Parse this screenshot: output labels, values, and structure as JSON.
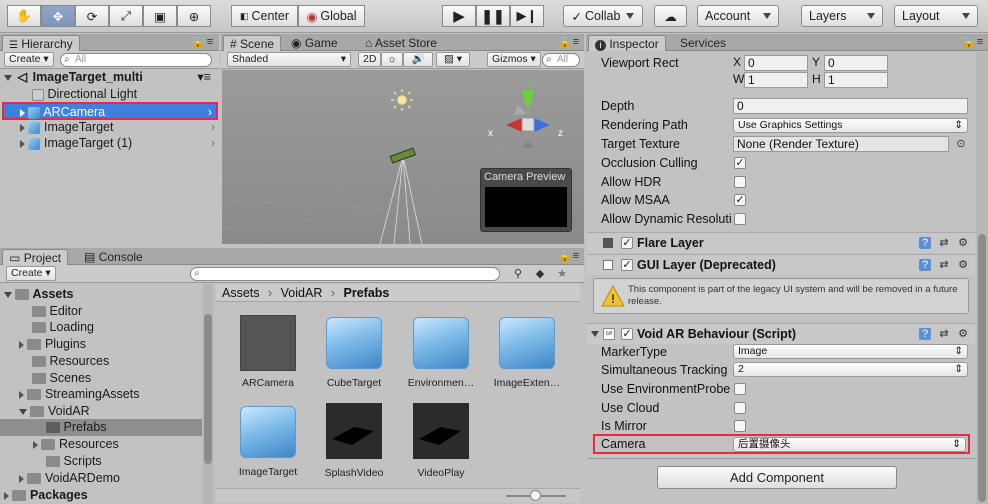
{
  "toolbar": {
    "pivot_label": "Center",
    "space_label": "Global",
    "collab_label": "Collab",
    "account_label": "Account",
    "layers_label": "Layers",
    "layout_label": "Layout"
  },
  "hierarchy": {
    "tab": "Hierarchy",
    "create_label": "Create",
    "search_placeholder": "All",
    "scene_name": "ImageTarget_multi",
    "items": [
      {
        "label": "Directional Light",
        "icon": "gameobject-icon"
      },
      {
        "label": "ARCamera",
        "icon": "cube-icon"
      },
      {
        "label": "ImageTarget",
        "icon": "cube-icon"
      },
      {
        "label": "ImageTarget (1)",
        "icon": "cube-icon"
      }
    ]
  },
  "scene": {
    "tabs": [
      "Scene",
      "Game",
      "Asset Store"
    ],
    "shading": "Shaded",
    "mode_2d": "2D",
    "gizmos_label": "Gizmos",
    "search_placeholder": "All",
    "axis_y": "y",
    "axis_x": "x",
    "axis_z": "z",
    "camera_preview": "Camera Preview"
  },
  "project": {
    "tabs": [
      "Project",
      "Console"
    ],
    "create_label": "Create",
    "tree": [
      {
        "label": "Assets",
        "bold": true
      },
      {
        "label": "Editor"
      },
      {
        "label": "Loading"
      },
      {
        "label": "Plugins"
      },
      {
        "label": "Resources"
      },
      {
        "label": "Scenes"
      },
      {
        "label": "StreamingAssets"
      },
      {
        "label": "VoidAR"
      },
      {
        "label": "Prefabs"
      },
      {
        "label": "Resources"
      },
      {
        "label": "Scripts"
      },
      {
        "label": "VoidARDemo"
      },
      {
        "label": "Packages",
        "bold": true
      }
    ],
    "breadcrumb": [
      "Assets",
      "VoidAR",
      "Prefabs"
    ],
    "assets": [
      {
        "label": "ARCamera"
      },
      {
        "label": "CubeTarget"
      },
      {
        "label": "Environmen…"
      },
      {
        "label": "ImageExten…"
      },
      {
        "label": "ImageTarget"
      },
      {
        "label": "SplashVideo"
      },
      {
        "label": "VideoPlay"
      }
    ]
  },
  "inspector": {
    "tabs": [
      "Inspector",
      "Services"
    ],
    "viewport_rect": {
      "label": "Viewport Rect",
      "x": "0",
      "y": "0",
      "w": "1",
      "h": "1",
      "x_label": "X",
      "y_label": "Y",
      "w_label": "W",
      "h_label": "H"
    },
    "depth": {
      "label": "Depth",
      "value": "0"
    },
    "rendering_path": {
      "label": "Rendering Path",
      "value": "Use Graphics Settings"
    },
    "target_texture": {
      "label": "Target Texture",
      "value": "None (Render Texture)"
    },
    "occlusion_culling": {
      "label": "Occlusion Culling",
      "checked": "✓"
    },
    "allow_hdr": {
      "label": "Allow HDR",
      "checked": ""
    },
    "allow_msaa": {
      "label": "Allow MSAA",
      "checked": "✓"
    },
    "allow_dynamic": {
      "label": "Allow Dynamic Resoluti",
      "checked": ""
    },
    "flare_layer": "Flare Layer",
    "gui_layer": "GUI Layer (Deprecated)",
    "warning": "This component is part of the legacy UI system and will be removed in a future release.",
    "void_ar": "Void AR Behaviour (Script)",
    "marker_type": {
      "label": "MarkerType",
      "value": "Image"
    },
    "simultaneous": {
      "label": "Simultaneous Tracking",
      "value": "2"
    },
    "use_env_probe": {
      "label": "Use EnvironmentProbe"
    },
    "use_cloud": {
      "label": "Use Cloud"
    },
    "is_mirror": {
      "label": "Is Mirror"
    },
    "camera": {
      "label": "Camera",
      "value": "后置摄像头"
    },
    "add_component": "Add Component"
  },
  "colors": {
    "selection": "#3d80df",
    "highlight_border": "#e8293f",
    "panel": "#c2c2c2"
  }
}
